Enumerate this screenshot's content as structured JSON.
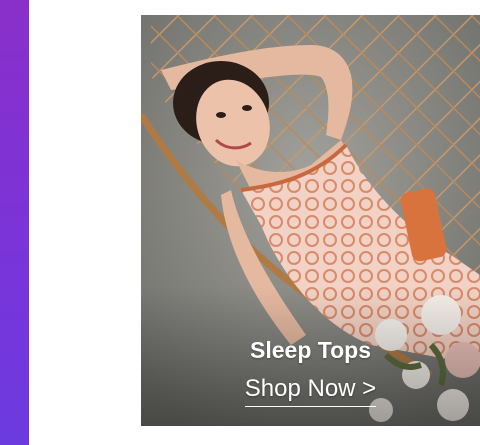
{
  "banner": {
    "title": "Sleep Tops",
    "cta_label": "Shop Now >"
  },
  "colors": {
    "accent_bar": "#7a34d8",
    "text": "#ffffff"
  }
}
